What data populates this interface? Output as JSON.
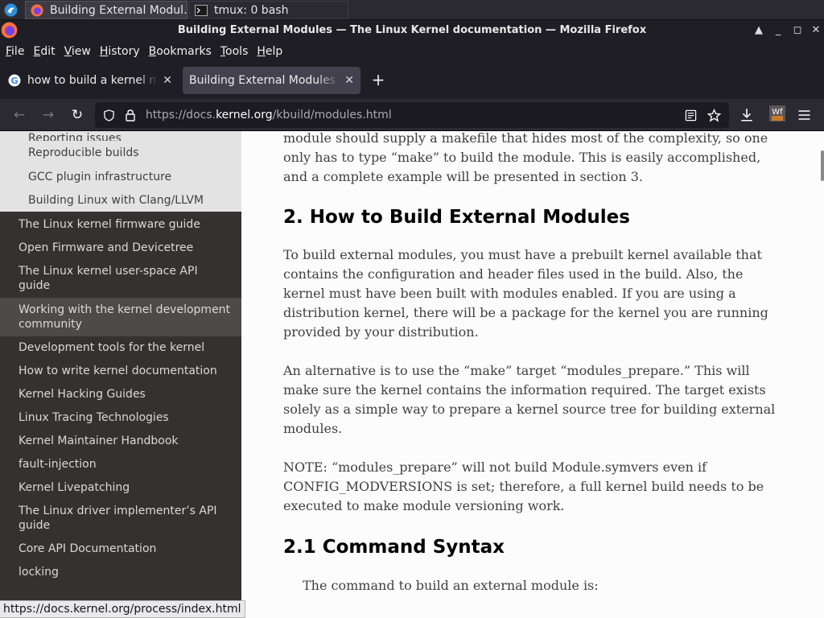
{
  "taskbar": {
    "tasks": [
      {
        "label": "Building External Modul…",
        "active": true
      },
      {
        "label": "tmux: 0 bash",
        "active": false
      }
    ]
  },
  "window": {
    "title": "Building External Modules — The Linux Kernel documentation — Mozilla Firefox",
    "controls": [
      "▲",
      "_",
      "◻",
      "✕"
    ]
  },
  "menubar": {
    "items": [
      {
        "first": "F",
        "rest": "ile"
      },
      {
        "first": "E",
        "rest": "dit"
      },
      {
        "first": "V",
        "rest": "iew"
      },
      {
        "first": "H",
        "rest": "istory"
      },
      {
        "first": "B",
        "rest": "ookmarks"
      },
      {
        "first": "T",
        "rest": "ools"
      },
      {
        "first": "H",
        "rest": "elp"
      }
    ]
  },
  "tabs": [
    {
      "label": "how to build a kernel mod",
      "close": "✕",
      "active": false
    },
    {
      "label": "Building External Modules — The Linux Kernel documentation",
      "close": "✕",
      "active": true
    }
  ],
  "newtab": "+",
  "navbar": {
    "back": "←",
    "forward": "→",
    "reload": "↻",
    "url_prefix": "https://docs.",
    "url_host": "kernel.org",
    "url_path": "/kbuild/modules.html"
  },
  "sidebar": {
    "cut_item": "Reporting issues",
    "sub_items": [
      "Reproducible builds",
      "GCC plugin infrastructure",
      "Building Linux with Clang/LLVM"
    ],
    "items": [
      "The Linux kernel firmware guide",
      "Open Firmware and Devicetree",
      "The Linux kernel user-space API guide",
      "Working with the kernel development community",
      "Development tools for the kernel",
      "How to write kernel documentation",
      "Kernel Hacking Guides",
      "Linux Tracing Technologies",
      "Kernel Maintainer Handbook",
      "fault-injection",
      "Kernel Livepatching",
      "The Linux driver implementer’s API guide",
      "Core API Documentation",
      "locking"
    ]
  },
  "content": {
    "intro": "module should supply a makefile that hides most of the complexity, so one only has to type “make” to build the module. This is easily accomplished, and a complete example will be presented in section 3.",
    "h2": "2. How to Build External Modules",
    "p1": "To build external modules, you must have a prebuilt kernel available that contains the configuration and header files used in the build. Also, the kernel must have been built with modules enabled. If you are using a distribution kernel, there will be a package for the kernel you are running provided by your distribution.",
    "p2": "An alternative is to use the “make” target “modules_prepare.” This will make sure the kernel contains the information required. The target exists solely as a simple way to prepare a kernel source tree for building external modules.",
    "p3": "NOTE: “modules_prepare” will not build Module.symvers even if CONFIG_MODVERSIONS is set; therefore, a full kernel build needs to be executed to make module versioning work.",
    "h3": "2.1 Command Syntax",
    "p4": "The command to build an external module is:"
  },
  "statusbar": {
    "text": "https://docs.kernel.org/process/index.html"
  },
  "colors": {
    "sidebar_bg": "#343131",
    "sidebar_sub_bg": "#e3e3e3",
    "content_bg": "#fcfcfc",
    "browser_chrome": "#1f1e25"
  }
}
